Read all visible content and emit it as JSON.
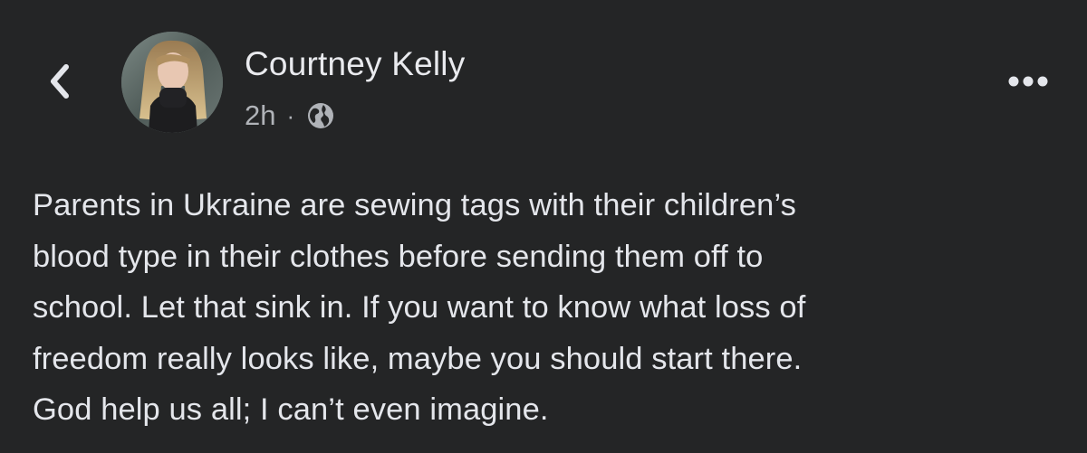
{
  "header": {
    "back_icon": "chevron-left-icon",
    "author_name": "Courtney Kelly",
    "timestamp": "2h",
    "separator": "·",
    "audience_icon": "globe-icon",
    "more_icon": "more-horizontal-icon"
  },
  "post": {
    "lines": [
      "Parents in Ukraine are sewing tags with their children’s",
      "blood type in their clothes before sending them off to",
      "school. Let that sink in. If you want to know what loss of",
      "freedom really looks like, maybe you should start there.",
      "God help us all; I can’t even imagine."
    ]
  },
  "colors": {
    "background": "#242526",
    "primary_text": "#e4e6eb",
    "secondary_text": "#b0b3b8"
  }
}
